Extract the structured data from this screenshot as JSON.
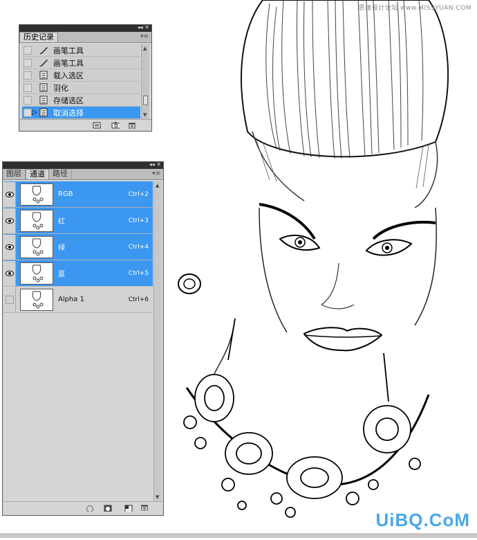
{
  "history_panel": {
    "tab_label": "历史记录",
    "items": [
      {
        "label": "画笔工具",
        "icon": "brush-icon",
        "selected": false
      },
      {
        "label": "画笔工具",
        "icon": "brush-icon",
        "selected": false
      },
      {
        "label": "载入选区",
        "icon": "document-icon",
        "selected": false
      },
      {
        "label": "羽化",
        "icon": "document-icon",
        "selected": false
      },
      {
        "label": "存储选区",
        "icon": "document-icon",
        "selected": false
      },
      {
        "label": "取消选择",
        "icon": "document-icon",
        "selected": true
      }
    ],
    "footer_buttons": [
      "new-document-from-state-icon",
      "snapshot-camera-icon",
      "trash-icon"
    ]
  },
  "channels_panel": {
    "tabs": [
      "图层",
      "通道",
      "路径"
    ],
    "active_tab": "通道",
    "channels": [
      {
        "name": "RGB",
        "shortcut": "Ctrl+2",
        "visible": true,
        "selected": true
      },
      {
        "name": "红",
        "shortcut": "Ctrl+3",
        "visible": true,
        "selected": true
      },
      {
        "name": "绿",
        "shortcut": "Ctrl+4",
        "visible": true,
        "selected": true
      },
      {
        "name": "蓝",
        "shortcut": "Ctrl+5",
        "visible": true,
        "selected": true
      },
      {
        "name": "Alpha 1",
        "shortcut": "Ctrl+6",
        "visible": false,
        "selected": false
      }
    ],
    "footer_buttons": [
      "load-channel-as-selection-icon",
      "save-selection-as-channel-icon",
      "new-channel-icon",
      "trash-icon"
    ]
  },
  "watermark": {
    "top": "思缘设计论坛 www.MISSYUAN.COM",
    "bottom": "UiBQ.CoM"
  },
  "colors": {
    "selection": "#3b97f0",
    "panel_bg": "#d6d6d6",
    "titlebar": "#2f2f2f"
  }
}
